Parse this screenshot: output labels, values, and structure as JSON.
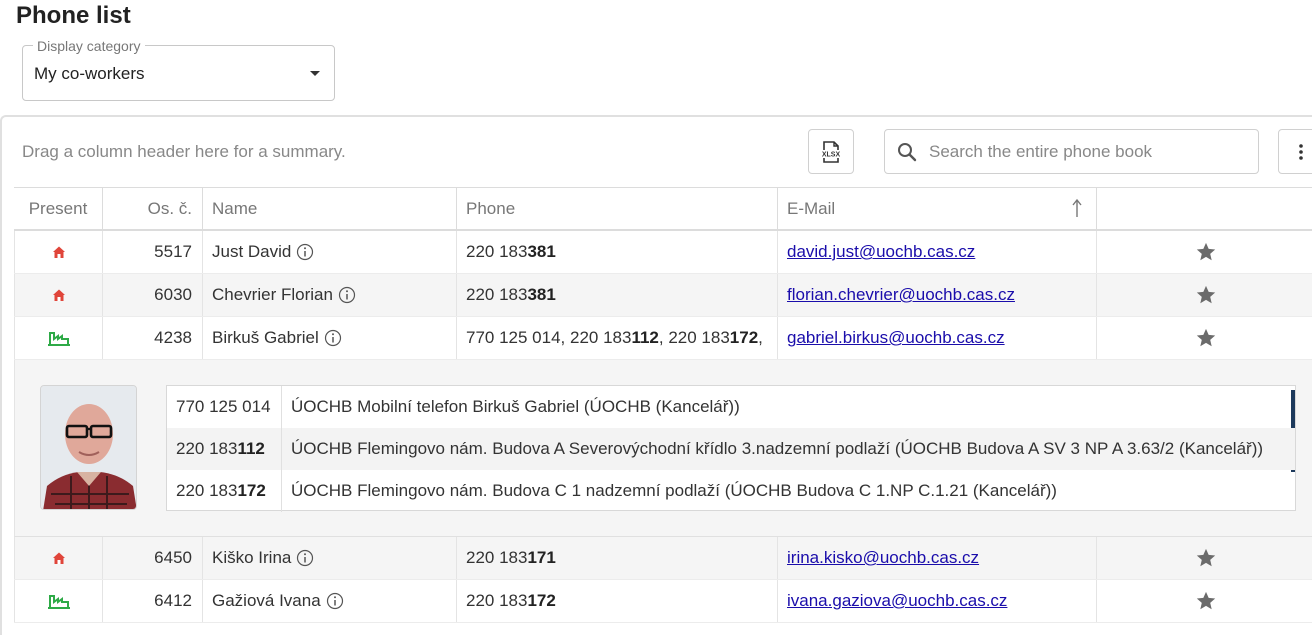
{
  "page": {
    "title": "Phone list"
  },
  "category_select": {
    "label": "Display category",
    "value": "My co-workers"
  },
  "toolbar": {
    "group_hint": "Drag a column header here for a summary.",
    "export_icon": "xlsx-export-icon",
    "search_placeholder": "Search the entire phone book",
    "more_icon": "more-vertical-icon"
  },
  "columns": {
    "present": "Present",
    "osc": "Os. č.",
    "name": "Name",
    "phone": "Phone",
    "email": "E-Mail"
  },
  "colors": {
    "home": "#e0453a",
    "office": "#2eaa47",
    "star": "#6b6b6b",
    "link": "#1a0dab",
    "scroll_accent": "#1d3a5c"
  },
  "rows": [
    {
      "status": "home-icon",
      "osc": "5517",
      "name": "Just David",
      "phone": [
        {
          "prefix": "220 183 ",
          "ext": "381"
        }
      ],
      "email": "david.just@uochb.cas.cz",
      "alt": false
    },
    {
      "status": "home-icon",
      "osc": "6030",
      "name": "Chevrier Florian",
      "phone": [
        {
          "prefix": "220 183 ",
          "ext": "381"
        }
      ],
      "email": "florian.chevrier@uochb.cas.cz",
      "alt": true
    },
    {
      "status": "office-icon",
      "osc": "4238",
      "name": "Birkuš Gabriel",
      "phone": [
        {
          "prefix": "770 125 014, 220 183 ",
          "ext": "112"
        },
        {
          "prefix": ", 220 183 ",
          "ext": "172"
        },
        {
          "prefix": ",",
          "ext": ""
        }
      ],
      "email": "gabriel.birkus@uochb.cas.cz",
      "alt": false,
      "expanded": true
    }
  ],
  "detail": {
    "photo_icon": "person-photo",
    "phones": [
      {
        "prefix": "770 125 014",
        "ext": "",
        "desc": "ÚOCHB Mobilní telefon Birkuš Gabriel (ÚOCHB (Kancelář))"
      },
      {
        "prefix": "220 183 ",
        "ext": "112",
        "desc": "ÚOCHB Flemingovo nám. Budova A Severovýchodní křídlo 3.nadzemní podlaží (ÚOCHB Budova A SV 3 NP A 3.63/2 (Kancelář))"
      },
      {
        "prefix": "220 183 ",
        "ext": "172",
        "desc": "ÚOCHB Flemingovo nám. Budova C 1 nadzemní podlaží (ÚOCHB Budova C 1.NP C.1.21 (Kancelář))"
      }
    ]
  },
  "rows_after": [
    {
      "status": "home-icon",
      "osc": "6450",
      "name": "Kiško Irina",
      "phone": [
        {
          "prefix": "220 183 ",
          "ext": "171"
        }
      ],
      "email": "irina.kisko@uochb.cas.cz",
      "alt": true
    },
    {
      "status": "office-icon",
      "osc": "6412",
      "name": "Gažiová Ivana",
      "phone": [
        {
          "prefix": "220 183 ",
          "ext": "172"
        }
      ],
      "email": "ivana.gaziova@uochb.cas.cz",
      "alt": false
    }
  ]
}
